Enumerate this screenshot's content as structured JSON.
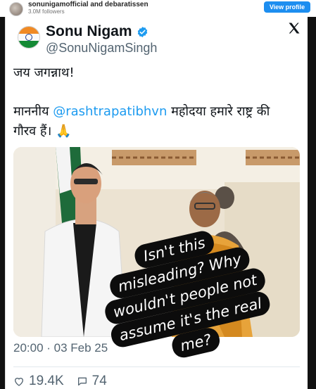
{
  "instagram_header": {
    "username": "sonunigamofficial and debaratissen",
    "followers": "3.0M followers",
    "view_profile_label": "View profile"
  },
  "tweet": {
    "display_name": "Sonu Nigam",
    "handle": "@SonuNigamSingh",
    "x_logo": "𝕏",
    "line1": "जय जगन्नाथ!",
    "body_before_mention": "माननीय ",
    "mention": "@rashtrapatibhvn",
    "body_after_mention": " महोदया हमारे राष्ट्र की गौरव हैं। 🙏",
    "timestamp": "20:00 · 03 Feb 25",
    "likes": "19.4K",
    "replies": "74"
  },
  "overlay_comment": {
    "lines": [
      "Isn't this",
      "misleading? Why",
      "wouldn't people not",
      "assume it's the real",
      "me?"
    ]
  },
  "colors": {
    "accent_blue": "#1d9bf0",
    "view_profile_bg": "#1d8ef0",
    "text_primary": "#0f1419",
    "text_secondary": "#536471",
    "frame_dark": "#111111"
  },
  "icons": {
    "verified": "verified-badge-icon",
    "x_logo": "x-logo-icon",
    "like": "heart-icon",
    "reply": "speech-bubble-icon"
  }
}
